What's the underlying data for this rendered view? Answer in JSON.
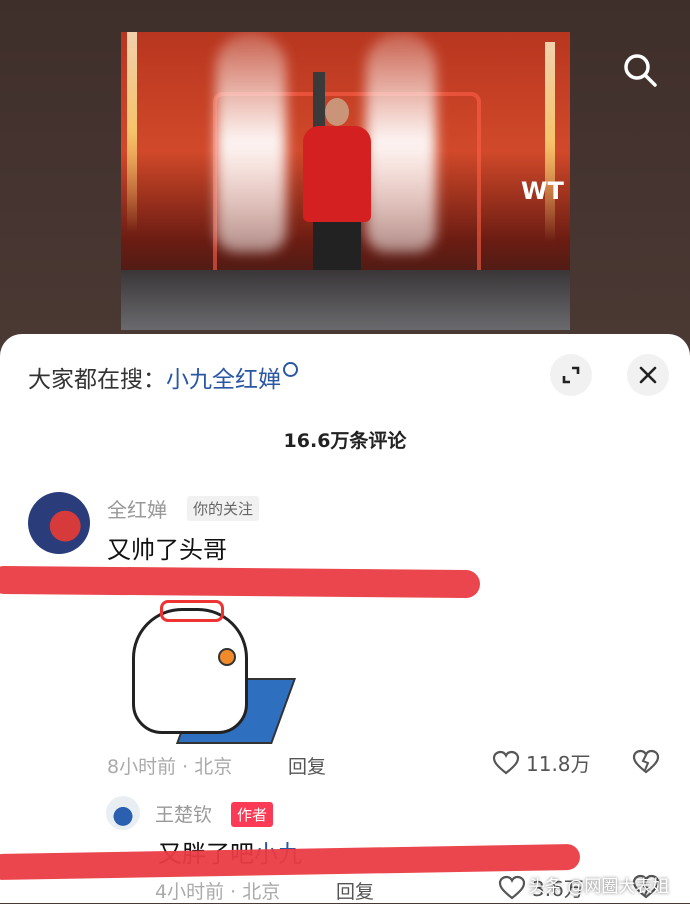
{
  "video": {
    "overlay_text": "WT",
    "search_icon": "search-icon"
  },
  "panel": {
    "search_prefix": "大家都在搜：",
    "search_keyword": "小九全红婵",
    "comment_count": "16.6万条评论",
    "expand_icon": "expand-icon",
    "close_icon": "close-icon"
  },
  "comments": [
    {
      "username": "全红婵",
      "tag": "你的关注",
      "text": "又帅了头哥",
      "time_location": "8小时前 · 北京",
      "reply_label": "回复",
      "likes": "11.8万"
    },
    {
      "username": "王楚钦",
      "tag": "作者",
      "text_prefix": "又胖了吧",
      "text_keyword": "小九",
      "time_location": "4小时前 · 北京",
      "reply_label": "回复",
      "likes": "3.6万"
    }
  ],
  "watermark": "头条 @网圈大表姐",
  "colors": {
    "keyword": "#2a57a4",
    "author_tag": "#fb3a55",
    "highlight_mark": "#ea3b43"
  }
}
